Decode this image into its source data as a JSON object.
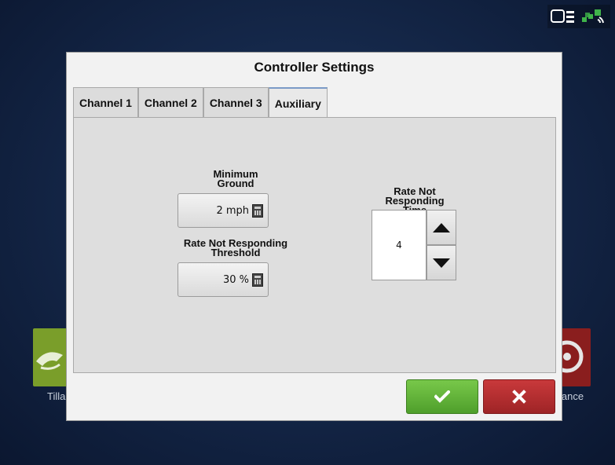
{
  "dialog": {
    "title": "Controller Settings",
    "tabs": [
      {
        "label": "Channel 1"
      },
      {
        "label": "Channel 2"
      },
      {
        "label": "Channel 3"
      },
      {
        "label": "Auxiliary",
        "active": true
      }
    ]
  },
  "fields": {
    "min_ground": {
      "label_line1": "Minimum",
      "label_line2": "Ground",
      "value": "2 mph"
    },
    "threshold": {
      "label_line1": "Rate Not Responding",
      "label_line2": "Threshold",
      "value": "30 %"
    },
    "resp_time": {
      "label_line1": "Rate Not",
      "label_line2": "Responding",
      "label_line3": "Time",
      "value": "4"
    }
  },
  "background": {
    "left_tile_label": "Tilla",
    "right_tile_label": "lance"
  },
  "colors": {
    "ok": "#5aaf33",
    "cancel": "#b02e30",
    "active_tab_accent": "#7b9ac7"
  },
  "icons": {
    "status_display": "display-icon",
    "status_gps": "satellite-icon",
    "calculator": "calculator-icon",
    "up": "arrow-up-icon",
    "down": "arrow-down-icon",
    "ok": "check-icon",
    "cancel": "close-icon"
  }
}
